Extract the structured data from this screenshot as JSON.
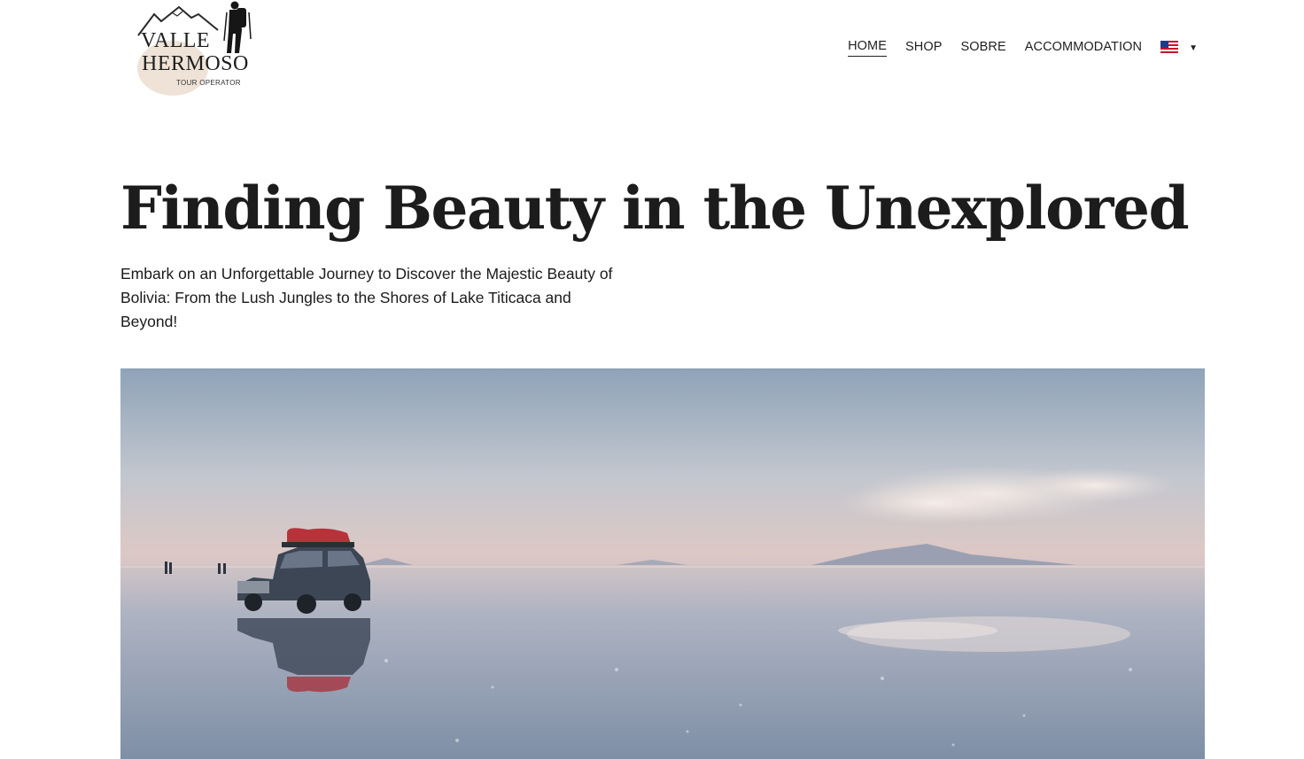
{
  "header": {
    "logo": {
      "line1": "VALLE",
      "line2": "HERMOSO",
      "line3": "TOUR OPERATOR"
    },
    "nav": [
      {
        "label": "HOME",
        "active": true
      },
      {
        "label": "SHOP",
        "active": false
      },
      {
        "label": "SOBRE",
        "active": false
      },
      {
        "label": "ACCOMMODATION",
        "active": false
      }
    ],
    "language": {
      "icon": "us-flag-icon",
      "caret": "▼"
    }
  },
  "hero": {
    "title": "Finding Beauty in the Unexplored",
    "subtitle": "Embark on an Unforgettable Journey to Discover the Majestic Beauty of Bolivia: From the Lush Jungles to the Shores of Lake Titicaca and Beyond!"
  },
  "colors": {
    "text": "#1b1b1b",
    "logo_circle": "#efe3d8",
    "sky_top": "#8fa3b8",
    "horizon": "#d8c8c4"
  }
}
